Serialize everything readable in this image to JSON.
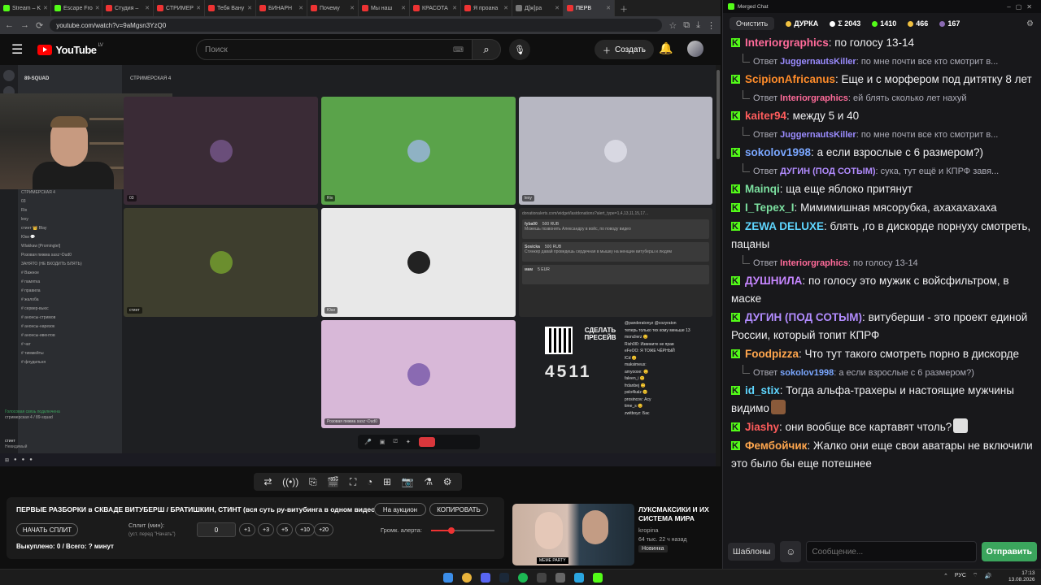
{
  "browser": {
    "tabs": [
      {
        "label": "Stream – K",
        "color": "#53fc18"
      },
      {
        "label": "Escape Fro",
        "color": "#53fc18"
      },
      {
        "label": "Студия –",
        "color": "#e33"
      },
      {
        "label": "СТРИМЕР",
        "color": "#e33"
      },
      {
        "label": "Тебя Вану",
        "color": "#e33"
      },
      {
        "label": "БИНАРН",
        "color": "#e33"
      },
      {
        "label": "Почему",
        "color": "#e33"
      },
      {
        "label": "Мы наш",
        "color": "#e33"
      },
      {
        "label": "КРАСОТА",
        "color": "#e33"
      },
      {
        "label": "Я проана",
        "color": "#e33"
      },
      {
        "label": "Д[ж]ра",
        "color": "#777"
      },
      {
        "label": "ПЕРВ",
        "color": "#e33"
      }
    ],
    "url": "youtube.com/watch?v=9aMgsn3YzQ0"
  },
  "youtube": {
    "logo_text": "YouTube",
    "region": "LV",
    "search_placeholder": "Поиск",
    "create_label": "Создать"
  },
  "discord": {
    "server_name": "89-SQUAD",
    "voice_channel": "СТРИМЕРСКАЯ 4",
    "channels": [
      "СТРИМЕРСКАЯ 4",
      "03",
      "Rix",
      "lexy",
      "стинт 👑 Blay",
      "Юки 💬 ",
      "Wlakkaw [Promingtel]",
      "Розовая пижма sasz~Dud0",
      "ЗАНЯТО (НЕ ВХОДИТЬ БЛЯТЬ)",
      "# Важное",
      "# памятка",
      "# правила",
      "# жалоба",
      "# сервер-вьюс",
      "# анонсы-стримов",
      "# анонсы-нарезок",
      "# анонсы-ивентов",
      "# чат",
      "# тиммейты",
      "# флудильня"
    ],
    "voice_status": "Голосовая связь подключена",
    "voice_channel_path": "стримерская 4 / 89-squad",
    "user_name": "стинт",
    "user_status": "Невидимый",
    "tiles": [
      {
        "label": "03",
        "bg": "#3a2b36",
        "avatar": "#6a4e7a"
      },
      {
        "label": "Rix",
        "bg": "#5aa34a",
        "avatar": "#8fb2c4"
      },
      {
        "label": "lexy",
        "bg": "#b7b7c2",
        "avatar": "#d8d8e2"
      },
      {
        "label": "стинт",
        "bg": "#3e3e2e",
        "avatar": "#6b8e2e"
      },
      {
        "label": "Юки",
        "bg": "#e8e8e8",
        "avatar": "#222222"
      },
      {
        "label": "Розовая пижма sasz~Dud0",
        "bg": "#d8b8d8",
        "avatar": "#8a6ab2"
      }
    ],
    "donation_url": "donationalerts.com/widget/lastdonations?alert_type=1,4,13,11,15,17...",
    "donations": [
      {
        "name": "fyba00",
        "amount": "500 RUB",
        "text": "Можешь позвонить Александру в войс, по поводу видео"
      },
      {
        "name": "Sosicka",
        "amount": "500 RUB",
        "text": "Стинкер давай проведешь сердечная в мышку на женщин витуберш и людям"
      },
      {
        "name": "мам",
        "amount": "5 EUR",
        "text": ""
      }
    ],
    "qr_title": "СДЕЛАТЬ ПРЕСЕЙВ",
    "counter": "4511",
    "side_chat": [
      "@panderatonyz @cozyraton",
      "теперь только тех кому меньше 13",
      "monclierz 😊",
      "Rish0l0: Извините не прав",
      "eFeOO: Я ТОЖЕ ЧЁРНЫЙ",
      "lCd 😊",
      "maksimeus:",
      "amyooxe: 😊",
      "faleen_i 😊",
      "frdanbej 😊",
      "pslo4kalz 😊",
      "prosincov: Асу",
      "time_s 😊",
      "zwitboyz: Бас"
    ]
  },
  "controls": {
    "title": "ПЕРВЫЕ РАЗБОРКИ в СКВАДЕ ВИТУБЕРШ / БРАТИШКИН, СТИНТ (вся суть ру-витубинга в одном видео)",
    "auction_label": "На аукцион",
    "copy_label": "КОПИРОВАТЬ",
    "start_split_label": "НАЧАТЬ СПЛИТ",
    "split_label": "Сплит (мин):",
    "split_hint": "(уст. перед \"Начать\")",
    "split_value": "0",
    "increments": [
      "+1",
      "+3",
      "+5",
      "+10",
      "+20"
    ],
    "volume_label": "Громк. алерта:",
    "volume_fraction": 0.32,
    "bought_text": "Выкуплено: 0 / Всего: ? минут"
  },
  "recommended": {
    "title": "ЛУКСМАКСИКИ И ИХ СИСТЕМА МИРА",
    "channel": "kropina",
    "meta": "64 тыс.   22 ч назад",
    "badge": "Новинка",
    "thumb_caption": "МЕМЕ PARTY"
  },
  "chat": {
    "window_title": "Merged Chat",
    "clear_label": "Очистить",
    "stats": [
      {
        "label": "ДУРКА",
        "color": "#f0c040"
      },
      {
        "label": "Σ 2043",
        "color": "#ffffff"
      },
      {
        "label": "1410",
        "color": "#53fc18"
      },
      {
        "label": "466",
        "color": "#f0c040"
      },
      {
        "label": "167",
        "color": "#8a6ab2"
      }
    ],
    "messages": [
      {
        "type": "msg",
        "user": "Interiorgraphics",
        "color": "#ff6b9a",
        "text": "по голосу 13-14"
      },
      {
        "type": "reply",
        "prefix": "Ответ",
        "user": "JuggernautsKiller",
        "color": "#9b8cff",
        "text": "по мне почти все кто смотрит в..."
      },
      {
        "type": "msg",
        "user": "ScipionAfricanus",
        "color": "#ff8c2a",
        "text": "Еще и с морфером под дитятку 8 лет"
      },
      {
        "type": "reply",
        "prefix": "Ответ",
        "user": "Interiorgraphics",
        "color": "#ff6b9a",
        "text": "ей блять сколько лет нахуй"
      },
      {
        "type": "msg",
        "user": "kaiter94",
        "color": "#ff5c5c",
        "text": "между 5 и 40"
      },
      {
        "type": "reply",
        "prefix": "Ответ",
        "user": "JuggernautsKiller",
        "color": "#9b8cff",
        "text": "по мне почти все кто смотрит в..."
      },
      {
        "type": "msg",
        "user": "sokolov1998",
        "color": "#7aa7ff",
        "text": "а если взрослые с 6 размером?)"
      },
      {
        "type": "reply",
        "prefix": "Ответ",
        "user": "ДУГИН (ПОД СОТЫМ)",
        "color": "#b28cff",
        "text": "сука, тут ещё и КПРФ завя..."
      },
      {
        "type": "msg",
        "user": "Mainqi",
        "color": "#7ce0a0",
        "text": "ща еще яблоко притянут"
      },
      {
        "type": "msg",
        "user": "I_Tepex_I",
        "color": "#7ce0a0",
        "text": "Мимимишная мясорубка, ахахахахаха"
      },
      {
        "type": "msg",
        "user": "ZEWA DELUXE",
        "color": "#5fd6ff",
        "text": "блять ,го в дискорде порнуху смотреть, пацаны"
      },
      {
        "type": "reply",
        "prefix": "Ответ",
        "user": "Interiorgraphics",
        "color": "#ff6b9a",
        "text": "по голосу 13-14"
      },
      {
        "type": "msg",
        "user": "ДУШНИЛА",
        "color": "#c686ff",
        "text": "по голосу это мужик с войсфильтром, в маске"
      },
      {
        "type": "msg",
        "user": "ДУГИН (ПОД СОТЫМ)",
        "color": "#b28cff",
        "text": "витуберши - это проект единой России, который топит КПРФ"
      },
      {
        "type": "msg",
        "user": "Foodpizza",
        "color": "#ffa64d",
        "text": "Что тут такого смотреть порно в дискорде"
      },
      {
        "type": "reply",
        "prefix": "Ответ",
        "user": "sokolov1998",
        "color": "#7aa7ff",
        "text": "а если взрослые с 6 размером?)"
      },
      {
        "type": "msg",
        "user": "id_stix",
        "color": "#5fd6ff",
        "text": "Тогда альфа-трахеры и настоящие мужчины видимо",
        "emote": "#8a5a3a"
      },
      {
        "type": "msg",
        "user": "Jiashy",
        "color": "#ff5c5c",
        "text": "они вообще все картавят чтоль?",
        "emote": "#e0e0e0"
      },
      {
        "type": "msg",
        "user": "Фембойчик",
        "color": "#ffa64d",
        "text": "Жалко они еще свои аватары не включили это было бы еще потешнее"
      }
    ],
    "templates_label": "Шаблоны",
    "input_placeholder": "Сообщение...",
    "send_label": "Отправить"
  },
  "taskbar": {
    "tray_lang": "РУС",
    "time": "17:13",
    "date": "13.08.2026"
  }
}
